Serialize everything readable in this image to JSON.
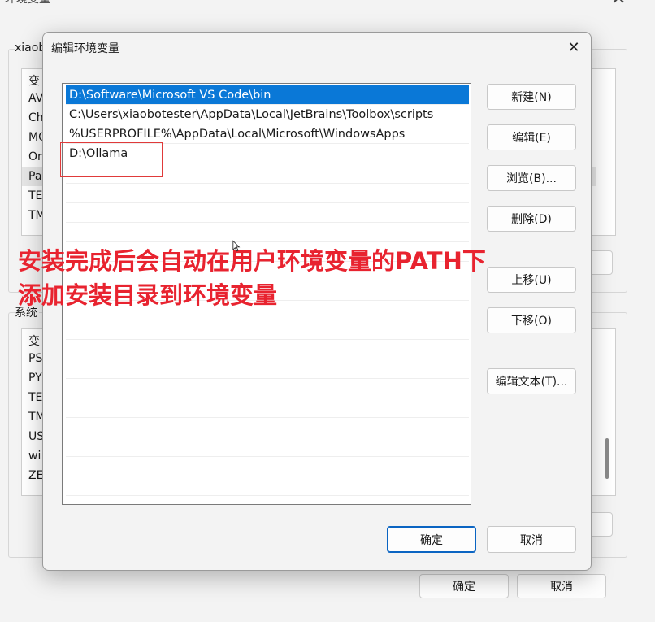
{
  "background": {
    "window_title": "环境变量",
    "user_group_label": "xiaob",
    "user_vars_rows": [
      "变",
      "AV",
      "Ch",
      "MO",
      "On",
      "Pa",
      "TE",
      "TM"
    ],
    "system_group_label": "系统",
    "system_vars_rows": [
      "变",
      "PS",
      "PY",
      "TE",
      "TM",
      "US",
      "wi",
      "ZE"
    ],
    "ok_label": "确定",
    "cancel_label": "取消",
    "close_icon": "close-icon"
  },
  "dialog": {
    "title": "编辑环境变量",
    "paths": [
      "D:\\Software\\Microsoft VS Code\\bin",
      "C:\\Users\\xiaobotester\\AppData\\Local\\JetBrains\\Toolbox\\scripts",
      "%USERPROFILE%\\AppData\\Local\\Microsoft\\WindowsApps",
      "D:\\Ollama"
    ],
    "selected_index": 0,
    "buttons": {
      "new": "新建(N)",
      "edit": "编辑(E)",
      "browse": "浏览(B)...",
      "delete": "删除(D)",
      "move_up": "上移(U)",
      "move_down": "下移(O)",
      "edit_text": "编辑文本(T)..."
    },
    "ok_label": "确定",
    "cancel_label": "取消"
  },
  "annotation": {
    "line1": "安装完成后会自动在用户环境变量的PATH下",
    "line2": "添加安装目录到环境变量"
  },
  "colors": {
    "selection": "#0a78d7",
    "annotation": "#e8232f",
    "highlight_box": "#e03a3a"
  }
}
